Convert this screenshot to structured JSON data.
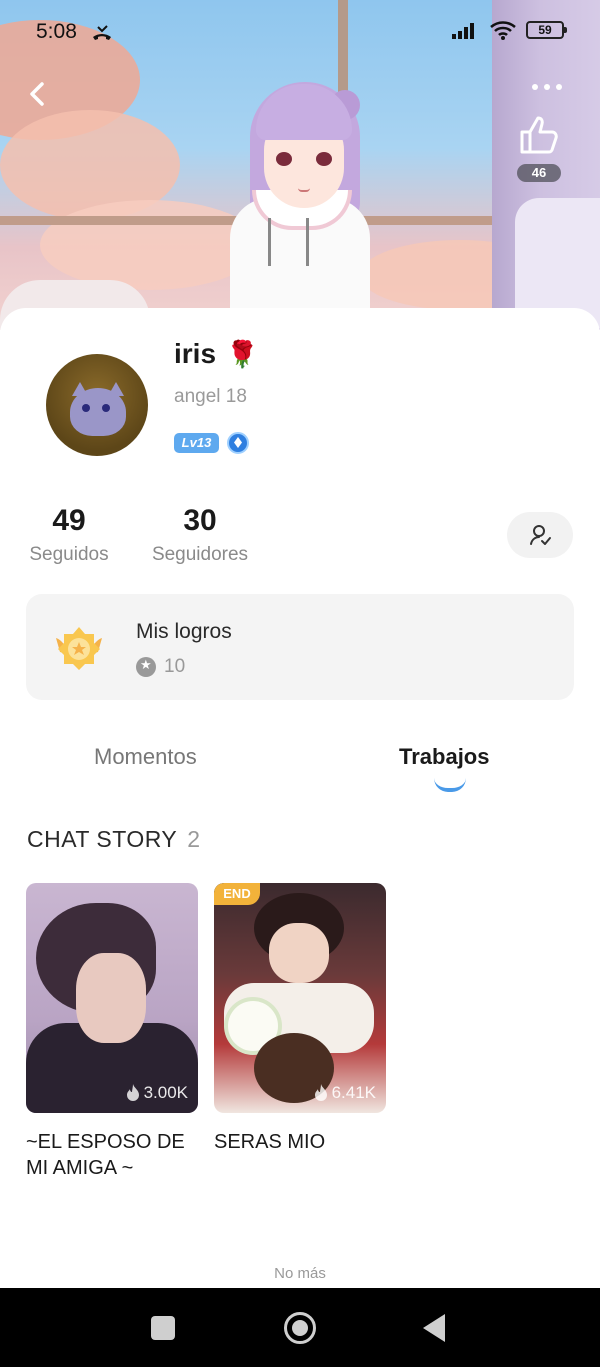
{
  "status_bar": {
    "time": "5:08",
    "battery": "59"
  },
  "hero": {
    "like_count": "46"
  },
  "profile": {
    "name": "iris",
    "name_emoji": "🌹",
    "subname": "angel 18",
    "level": "Lv13"
  },
  "stats": {
    "following": {
      "value": "49",
      "label": "Seguidos"
    },
    "followers": {
      "value": "30",
      "label": "Seguidores"
    }
  },
  "achievements": {
    "title": "Mis logros",
    "count": "10"
  },
  "tabs": [
    {
      "label": "Momentos",
      "active": false
    },
    {
      "label": "Trabajos",
      "active": true
    }
  ],
  "section": {
    "title": "CHAT STORY",
    "count": "2"
  },
  "stories": [
    {
      "title": "~EL ESPOSO DE MI AMIGA ~",
      "views": "3.00K",
      "badge": ""
    },
    {
      "title": "SERAS MIO",
      "views": "6.41K",
      "badge": "END"
    }
  ],
  "footer": {
    "no_more": "No más"
  },
  "colors": {
    "accent": "#4a9ae8",
    "level_badge": "#5ea9ef",
    "end_badge": "#f2b23a"
  }
}
